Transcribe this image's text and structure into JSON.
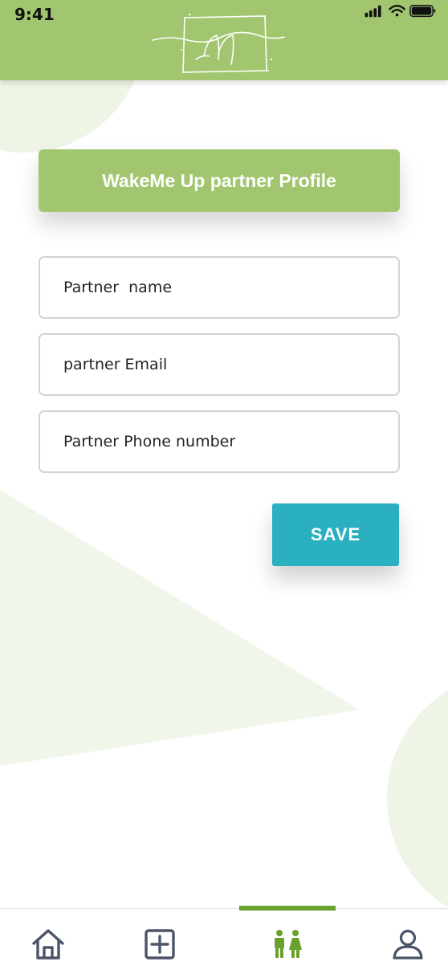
{
  "status_bar": {
    "time": "9:41",
    "icons": [
      "signal-icon",
      "wifi-icon",
      "battery-icon"
    ]
  },
  "header": {
    "logo": "app-logo",
    "background_color": "#a2c66f"
  },
  "title": "WakeMe Up partner Profile",
  "form": {
    "name_placeholder": "Partner  name",
    "email_placeholder": "partner Email",
    "phone_placeholder": "Partner Phone number"
  },
  "save_label": "SAVE",
  "colors": {
    "accent_green": "#a2c66f",
    "save_button": "#2bb0c2",
    "active_nav": "#6aa12c",
    "nav_icon": "#4b5568"
  },
  "bottom_nav": {
    "items": [
      {
        "icon": "home-icon",
        "active": false
      },
      {
        "icon": "add-square-icon",
        "active": false
      },
      {
        "icon": "partners-icon",
        "active": true
      },
      {
        "icon": "user-icon",
        "active": false
      }
    ]
  }
}
